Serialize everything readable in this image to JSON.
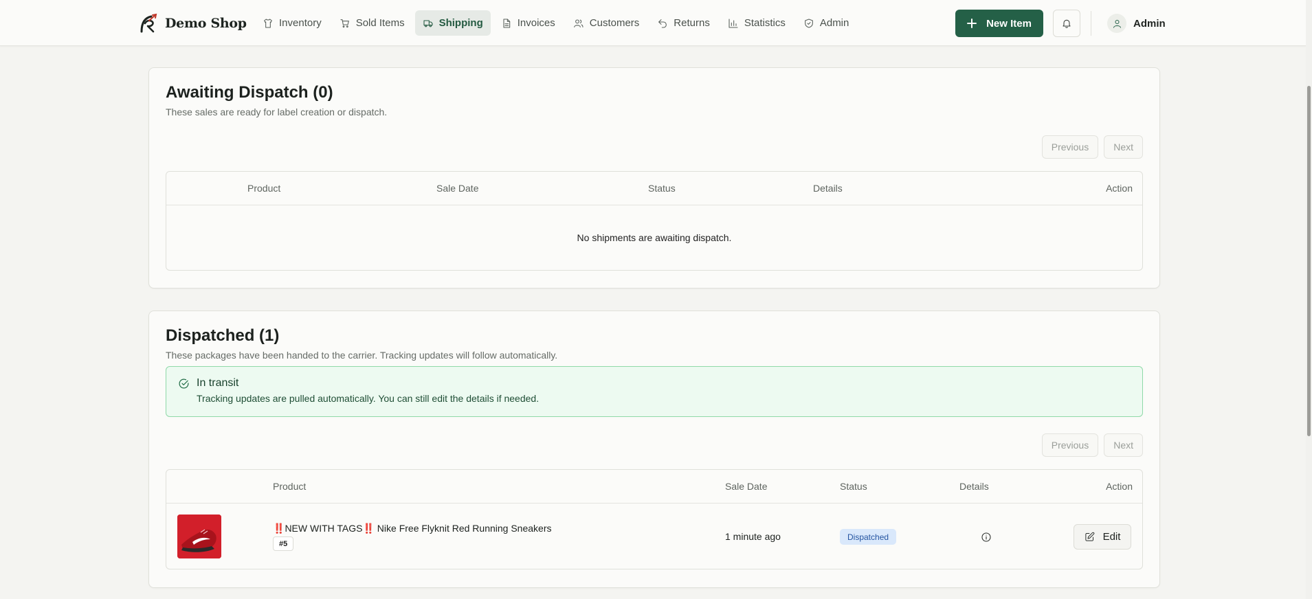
{
  "brand": {
    "name": "Demo Shop"
  },
  "nav": {
    "items": [
      {
        "label": "Inventory",
        "icon": "shirt-icon"
      },
      {
        "label": "Sold Items",
        "icon": "cart-icon"
      },
      {
        "label": "Shipping",
        "icon": "truck-icon",
        "active": true
      },
      {
        "label": "Invoices",
        "icon": "document-icon"
      },
      {
        "label": "Customers",
        "icon": "users-icon"
      },
      {
        "label": "Returns",
        "icon": "undo-icon"
      },
      {
        "label": "Statistics",
        "icon": "bar-chart-icon"
      },
      {
        "label": "Admin",
        "icon": "shield-icon"
      }
    ]
  },
  "header": {
    "new_item_label": "New Item",
    "user_name": "Admin"
  },
  "awaiting": {
    "title": "Awaiting Dispatch (0)",
    "subtitle": "These sales are ready for label creation or dispatch.",
    "pager": {
      "previous": "Previous",
      "next": "Next"
    },
    "columns": [
      "Product",
      "Sale Date",
      "Status",
      "Details",
      "Action"
    ],
    "empty_message": "No shipments are awaiting dispatch."
  },
  "dispatched": {
    "title": "Dispatched (1)",
    "subtitle": "These packages have been handed to the carrier. Tracking updates will follow automatically.",
    "alert": {
      "title": "In transit",
      "text": "Tracking updates are pulled automatically. You can still edit the details if needed."
    },
    "pager": {
      "previous": "Previous",
      "next": "Next"
    },
    "columns": [
      "Product",
      "Sale Date",
      "Status",
      "Details",
      "Action"
    ],
    "rows": [
      {
        "title_prefix": "‼️",
        "title_tag": "NEW WITH TAGS",
        "title_mid": "‼️",
        "title_rest": " Nike Free Flyknit Red Running Sneakers",
        "sku": "#5",
        "sale_date": "1 minute ago",
        "status": "Dispatched",
        "action_label": "Edit"
      }
    ]
  },
  "colors": {
    "accent": "#246047",
    "alert_border": "#8fd9a8",
    "alert_bg": "#edfaf1",
    "badge_bg": "#d9e8fb",
    "badge_text": "#2454a0"
  }
}
